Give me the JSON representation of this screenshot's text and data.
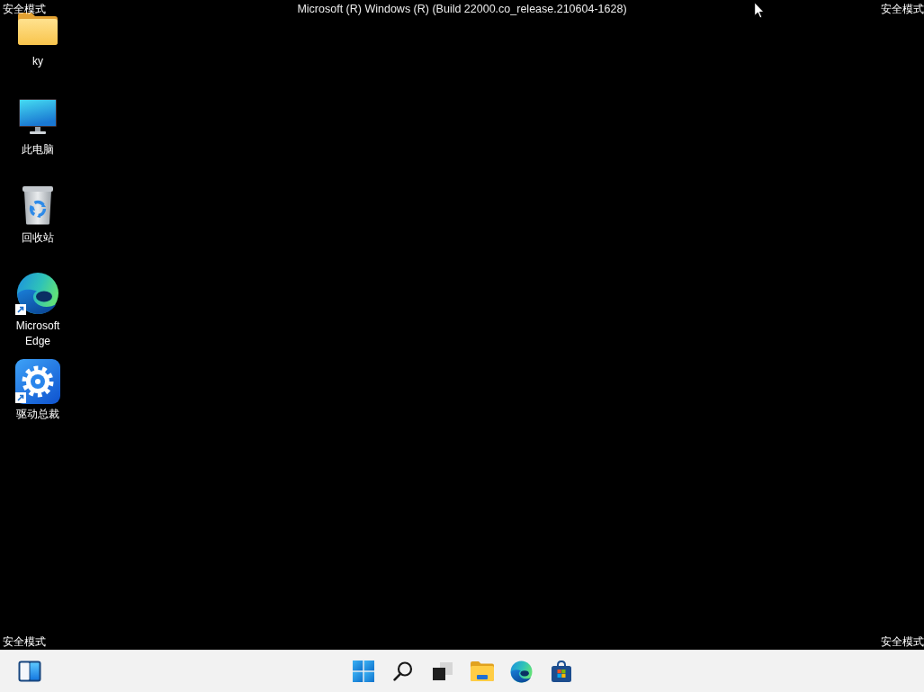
{
  "top_bar": {
    "left_label": "安全模式",
    "title": "Microsoft (R) Windows (R) (Build 22000.co_release.210604-1628)",
    "right_label": "安全模式"
  },
  "desktop_icons": [
    {
      "kind": "folder",
      "label": "ky",
      "shortcut": false
    },
    {
      "kind": "computer",
      "label": "此电脑",
      "shortcut": false
    },
    {
      "kind": "recycle-bin",
      "label": "回收站",
      "shortcut": false
    },
    {
      "kind": "edge",
      "label": "Microsoft Edge",
      "shortcut": true
    },
    {
      "kind": "driver-app",
      "label": "驱动总裁",
      "shortcut": true
    }
  ],
  "bottom_bar": {
    "left_label": "安全模式",
    "right_label": "安全模式"
  },
  "taskbar": {
    "left": [
      {
        "kind": "widgets"
      }
    ],
    "center": [
      {
        "kind": "start"
      },
      {
        "kind": "search"
      },
      {
        "kind": "task-view"
      },
      {
        "kind": "file-explorer"
      },
      {
        "kind": "edge"
      },
      {
        "kind": "store"
      }
    ]
  }
}
